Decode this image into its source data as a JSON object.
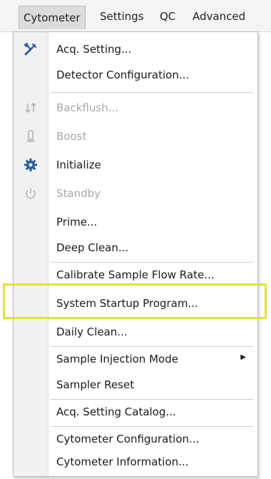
{
  "menubar": {
    "items": [
      "Cytometer",
      "Settings",
      "QC",
      "Advanced"
    ]
  },
  "menu": {
    "items": [
      {
        "label": "Acq. Setting...",
        "icon": "wrench-icon",
        "enabled": true
      },
      {
        "label": "Detector Configuration...",
        "icon": null,
        "enabled": true
      },
      {
        "label": "Backflush...",
        "icon": "backflush-icon",
        "enabled": false
      },
      {
        "label": "Boost",
        "icon": "boost-icon",
        "enabled": false
      },
      {
        "label": "Initialize",
        "icon": "gear-icon",
        "enabled": true
      },
      {
        "label": "Standby",
        "icon": "power-icon",
        "enabled": false
      },
      {
        "label": "Prime...",
        "icon": null,
        "enabled": true
      },
      {
        "label": "Deep Clean...",
        "icon": null,
        "enabled": true
      },
      {
        "label": "Calibrate Sample Flow Rate...",
        "icon": null,
        "enabled": true
      },
      {
        "label": "System Startup Program...",
        "icon": null,
        "enabled": true,
        "highlighted": true
      },
      {
        "label": "Daily Clean...",
        "icon": null,
        "enabled": true
      },
      {
        "label": "Sample Injection Mode",
        "icon": null,
        "enabled": true,
        "submenu": true
      },
      {
        "label": "Sampler Reset",
        "icon": null,
        "enabled": true
      },
      {
        "label": "Acq. Setting Catalog...",
        "icon": null,
        "enabled": true
      },
      {
        "label": "Cytometer Configuration...",
        "icon": null,
        "enabled": true
      },
      {
        "label": "Cytometer Information...",
        "icon": null,
        "enabled": true
      }
    ]
  },
  "colors": {
    "highlight_border": "#e2e23a",
    "disabled_text": "#a9a9a9",
    "icon_blue": "#2a5d9f"
  }
}
